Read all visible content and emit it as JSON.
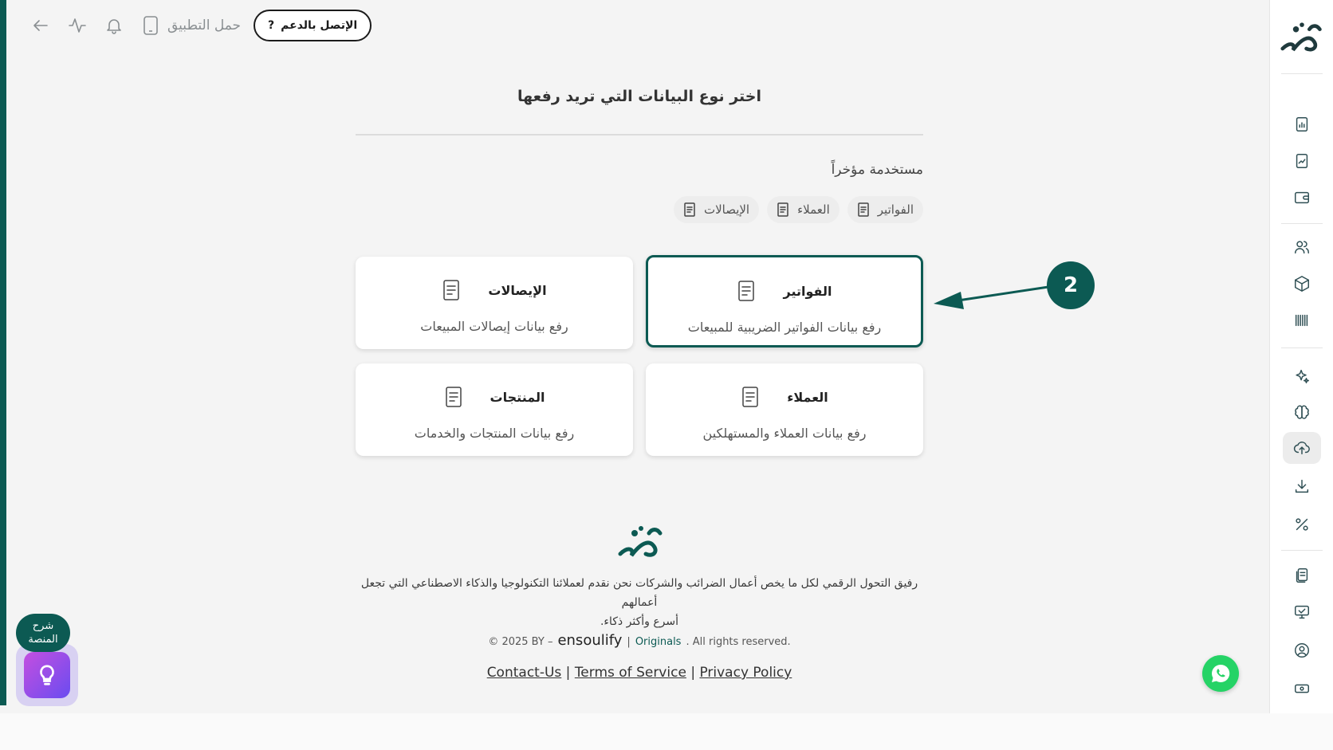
{
  "topbar": {
    "support_label": "الإتصل بالدعم",
    "support_icon": "?",
    "download_app_label": "حمل التطبيق",
    "icons": [
      "arrow-left-icon",
      "activity-icon",
      "bell-icon",
      "smartphone-icon"
    ]
  },
  "main": {
    "title": "اختر نوع البيانات التي تريد رفعها",
    "recent_label": "مستخدمة مؤخراً",
    "recent_chips": [
      {
        "label": "الفواتير"
      },
      {
        "label": "العملاء"
      },
      {
        "label": "الإيصالات"
      }
    ],
    "cards": [
      {
        "title": "الفواتير",
        "desc": "رفع بيانات الفواتير الضريبية للمبيعات",
        "selected": true
      },
      {
        "title": "الإيصالات",
        "desc": "رفع بيانات إيصالات المبيعات",
        "selected": false
      },
      {
        "title": "العملاء",
        "desc": "رفع بيانات العملاء والمستهلكين",
        "selected": false
      },
      {
        "title": "المنتجات",
        "desc": "رفع بيانات المنتجات والخدمات",
        "selected": false
      }
    ]
  },
  "annotation": {
    "step_number": "2"
  },
  "footer": {
    "tagline_line1": "رفيق التحول الرقمي لكل ما يخص أعمال الضرائب والشركات نحن نقدم لعملائنا التكنولوجيا والذكاء الاصطناعي التي تجعل أعمالهم",
    "tagline_line2": "أسرع وأكثر ذكاء.",
    "copyright_prefix": "© 2025 BY –",
    "brand": "ensoulify",
    "separator": "|",
    "originals": "Originals",
    "rights": ". All rights reserved.",
    "links": {
      "contact": "Contact-Us",
      "terms": "Terms of Service",
      "privacy": "Privacy Policy"
    }
  },
  "widgets": {
    "explain_label_line1": "شرح",
    "explain_label_line2": "المنصة"
  },
  "colors": {
    "accent": "#0c5a53",
    "whatsapp": "#25d366"
  }
}
